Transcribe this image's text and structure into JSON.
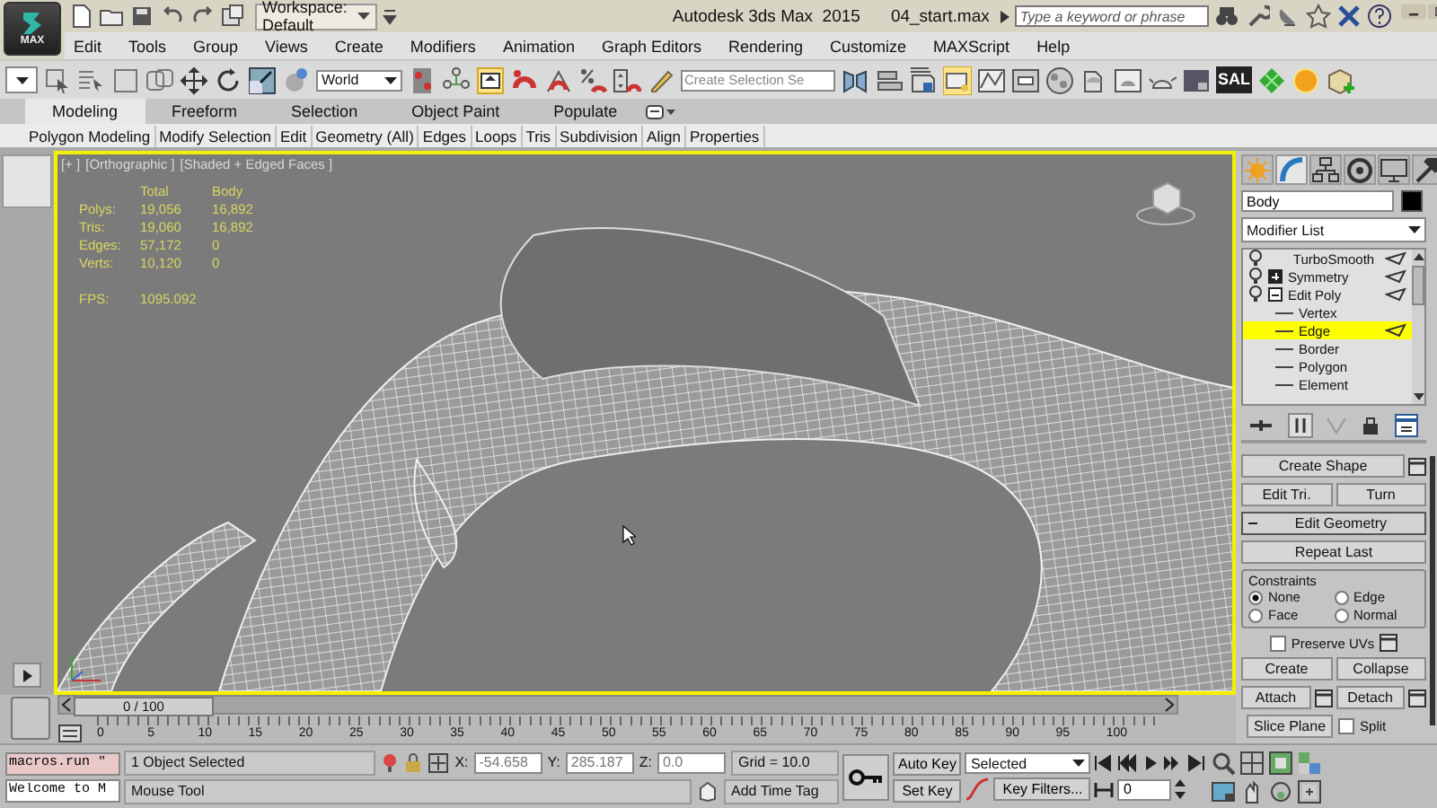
{
  "app": {
    "logo_label": "MAX"
  },
  "workspace": "Workspace: Default",
  "title": "Autodesk 3ds Max  2015",
  "file_name": "04_start.max",
  "search": {
    "placeholder": "Type a keyword or phrase"
  },
  "menu": [
    "Edit",
    "Tools",
    "Group",
    "Views",
    "Create",
    "Modifiers",
    "Animation",
    "Graph Editors",
    "Rendering",
    "Customize",
    "MAXScript",
    "Help"
  ],
  "toolbar": {
    "reference_coordinate": "World",
    "named_selection": {
      "placeholder": "Create Selection Se"
    },
    "plugin_label": "SAL"
  },
  "ribbon": {
    "tabs": [
      {
        "label": "Modeling",
        "selected": true
      },
      {
        "label": "Freeform",
        "selected": false
      },
      {
        "label": "Selection",
        "selected": false
      },
      {
        "label": "Object Paint",
        "selected": false
      },
      {
        "label": "Populate",
        "selected": false
      }
    ],
    "panels": [
      "Polygon Modeling",
      "Modify Selection",
      "Edit",
      "Geometry (All)",
      "Edges",
      "Loops",
      "Tris",
      "Subdivision",
      "Align",
      "Properties"
    ]
  },
  "viewport": {
    "labels": [
      "[+ ]",
      "[Orthographic ]",
      "[Shaded + Edged Faces ]"
    ],
    "stats": {
      "columns": [
        "Total",
        "Body"
      ],
      "rows": [
        {
          "label": "Polys:",
          "values": [
            "19,056",
            "16,892"
          ]
        },
        {
          "label": "Tris:",
          "values": [
            "19,060",
            "16,892"
          ]
        },
        {
          "label": "Edges:",
          "values": [
            "57,172",
            "0"
          ]
        },
        {
          "label": "Verts:",
          "values": [
            "10,120",
            "0"
          ]
        }
      ]
    },
    "fps": {
      "label": "FPS:",
      "value": "1095.092"
    }
  },
  "command_panel": {
    "tabs": [
      {
        "selected": false
      },
      {
        "selected": true
      },
      {
        "selected": false
      },
      {
        "selected": false
      },
      {
        "selected": false
      },
      {
        "selected": false
      }
    ],
    "object_name": "Body",
    "modifier_list": "Modifier List",
    "stack": [
      {
        "label": "TurboSmooth",
        "selected": false
      },
      {
        "label": "Symmetry",
        "expanded": false,
        "selected": false
      },
      {
        "label": "Edit Poly",
        "expanded": true,
        "selected": false,
        "children": [
          {
            "label": "Vertex",
            "selected": false
          },
          {
            "label": "Edge",
            "selected": true
          },
          {
            "label": "Border",
            "selected": false
          },
          {
            "label": "Polygon",
            "selected": false
          },
          {
            "label": "Element",
            "selected": false
          }
        ]
      }
    ],
    "create_shape": "Create Shape",
    "tri_buttons": [
      "Edit Tri.",
      "Turn"
    ],
    "edit_geometry": {
      "title": "Edit Geometry",
      "expanded": true,
      "repeat": "Repeat Last",
      "constraints_title": "Constraints",
      "constraints": [
        {
          "label": "None",
          "selected": true
        },
        {
          "label": "Edge",
          "selected": false
        },
        {
          "label": "Face",
          "selected": false
        },
        {
          "label": "Normal",
          "selected": false
        }
      ],
      "preserve_uvs": {
        "label": "Preserve UVs",
        "checked": false
      },
      "create": "Create",
      "collapse": "Collapse",
      "attach": "Attach",
      "detach": "Detach",
      "slice_plane": "Slice Plane",
      "split": {
        "label": "Split",
        "checked": false
      }
    }
  },
  "timeline": {
    "slider": "0 / 100",
    "ticks": [
      "0",
      "5",
      "10",
      "15",
      "20",
      "25",
      "30",
      "35",
      "40",
      "45",
      "50",
      "55",
      "60",
      "65",
      "70",
      "75",
      "80",
      "85",
      "90",
      "95",
      "100"
    ]
  },
  "status_bar": {
    "listener": "macros.run \"",
    "listener_output": "Welcome to M",
    "selection": "1 Object Selected",
    "prompt": "Mouse Tool",
    "coordinates": [
      {
        "label": "X:",
        "value": "-54.658"
      },
      {
        "label": "Y:",
        "value": "285.187"
      },
      {
        "label": "Z:",
        "value": "0.0"
      }
    ],
    "grid": "Grid = 10.0",
    "time_tag": "Add Time Tag",
    "auto_key": "Auto Key",
    "set_key": "Set Key",
    "key_mode": "Selected",
    "key_filters": "Key Filters...",
    "frame": "0"
  }
}
